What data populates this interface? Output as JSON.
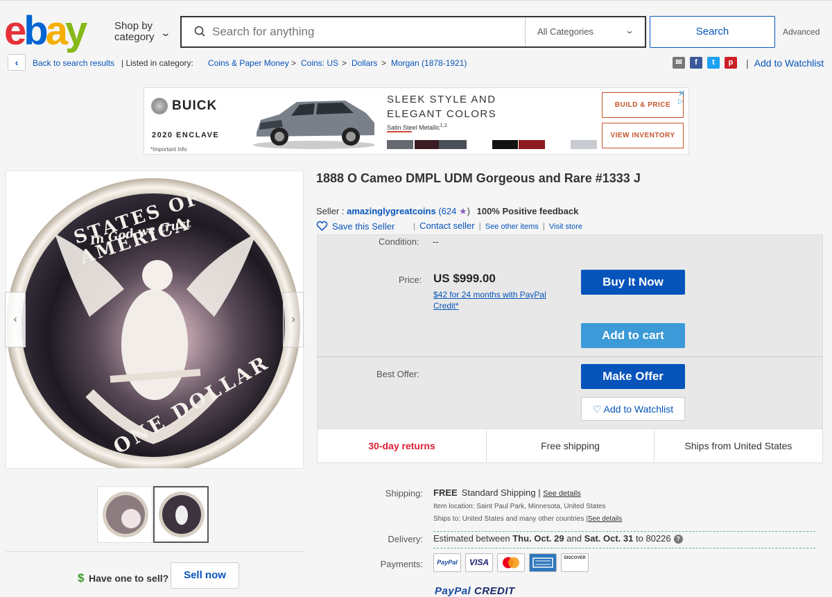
{
  "header": {
    "logo": [
      "e",
      "b",
      "a",
      "y"
    ],
    "shop_by_line1": "Shop by",
    "shop_by_line2": "category",
    "search_placeholder": "Search for anything",
    "category_selected": "All Categories",
    "search_button": "Search",
    "advanced": "Advanced"
  },
  "breadcrumb": {
    "back": "Back to search results",
    "listed_in": "| Listed in category:",
    "items": [
      "Coins & Paper Money",
      "Coins: US",
      "Dollars",
      "Morgan (1878-1921)"
    ],
    "separator": ">",
    "add_to_watchlist": "Add to Watchlist",
    "share_icons": [
      "email-icon",
      "facebook-icon",
      "twitter-icon",
      "pinterest-icon"
    ]
  },
  "ad": {
    "brand": "BUICK",
    "model": "2020 ENCLAVE",
    "info": "*Important Info",
    "headline_1": "SLEEK STYLE AND",
    "headline_2": "ELEGANT COLORS",
    "color_name": "Satin Steel Metallic",
    "color_sup": "1,2",
    "cta_build": "BUILD & PRICE",
    "cta_inventory": "VIEW INVENTORY",
    "swatch_colors": [
      "#666a70",
      "#3a1c22",
      "#4a4f57",
      "#ffffff",
      "#111111",
      "#8c1a1f",
      "#ffffff",
      "#c8ccd0"
    ]
  },
  "item": {
    "title": "1888 O Cameo DMPL UDM Gorgeous and Rare #1333 J",
    "seller_label": "Seller :",
    "seller_name": "amazinglygreatcoins",
    "seller_score": "(624",
    "seller_score_close": ")",
    "feedback": "100% Positive feedback",
    "save_seller": "Save this Seller",
    "contact_seller": "Contact seller",
    "see_other_items": "See other items",
    "visit_store": "Visit store",
    "condition_label": "Condition:",
    "condition_value": "--",
    "price_label": "Price:",
    "price_value": "US $999.00",
    "credit_offer": "$42 for 24 months with PayPal Credit*",
    "buy_it_now": "Buy It Now",
    "add_to_cart": "Add to cart",
    "best_offer_label": "Best Offer:",
    "make_offer": "Make Offer",
    "add_to_watchlist": "Add to Watchlist",
    "features": [
      "30-day returns",
      "Free shipping",
      "Ships from United States"
    ]
  },
  "shipping": {
    "shipping_label": "Shipping:",
    "free": "FREE",
    "method": "Standard Shipping",
    "sep": "|",
    "see_details": "See details",
    "item_location": "Item location:  Saint Paul Park, Minnesota, United States",
    "ships_to": "Ships to:  United States and many other countries",
    "ships_to_details": "See details",
    "delivery_label": "Delivery:",
    "delivery_pre": "Estimated between",
    "delivery_date1": "Thu. Oct. 29",
    "delivery_and": "and",
    "delivery_date2": "Sat. Oct. 31",
    "delivery_post": "to 80226",
    "payments_label": "Payments:",
    "payment_methods": [
      "PayPal",
      "VISA",
      "Mastercard",
      "AMEX",
      "DISCOVER"
    ],
    "paypal_credit_1": "PayPal",
    "paypal_credit_2": "CREDIT"
  },
  "left": {
    "have_one": "Have one to sell?",
    "sell_now": "Sell now",
    "dollar_icon": "$"
  },
  "coin": {
    "legend_top": "STATES OF AMERICA",
    "motto": "In God we trust",
    "legend_bottom": "ONE DOLLAR"
  }
}
